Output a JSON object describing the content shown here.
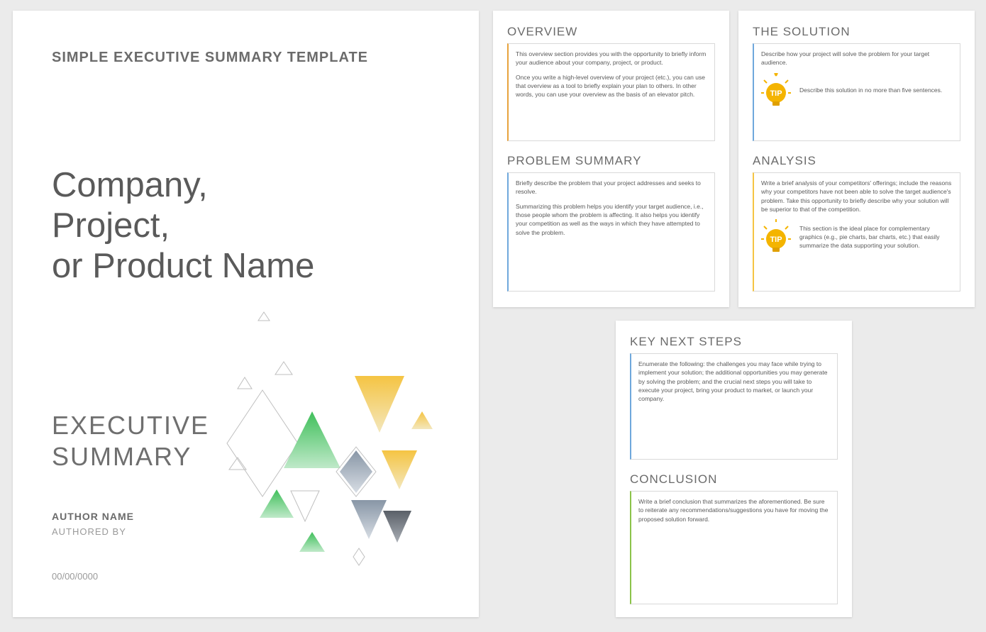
{
  "cover": {
    "template_title": "SIMPLE EXECUTIVE SUMMARY TEMPLATE",
    "main_title_l1": "Company,",
    "main_title_l2": "Project,",
    "main_title_l3": "or Product Name",
    "exec_l1": "EXECUTIVE",
    "exec_l2": "SUMMARY",
    "author_name": "AUTHOR NAME",
    "authored_by": "AUTHORED BY",
    "date": "00/00/0000"
  },
  "page2": {
    "overview": {
      "heading": "OVERVIEW",
      "p1": "This overview section provides you with the opportunity to briefly inform your audience about your company, project, or product.",
      "p2": "Once you write a high-level overview of your project (etc.), you can use that overview as a tool to briefly explain your plan to others. In other words, you can use your overview as the basis of an elevator pitch."
    },
    "problem": {
      "heading": "PROBLEM SUMMARY",
      "p1": "Briefly describe the problem that your project addresses and seeks to resolve.",
      "p2": "Summarizing this problem helps you identify your target audience, i.e., those people whom the problem is affecting. It also helps you identify your competition as well as the ways in which they have attempted to solve the problem."
    }
  },
  "page3": {
    "solution": {
      "heading": "THE SOLUTION",
      "p1": "Describe how your project will solve the problem for your target audience.",
      "tip": "Describe this solution in no more than five sentences."
    },
    "analysis": {
      "heading": "ANALYSIS",
      "p1": "Write a brief analysis of your competitors' offerings; include the reasons why your competitors have not been able to solve the target audience's problem. Take this opportunity to briefly describe why your solution will be superior to that of the competition.",
      "tip": "This section is the ideal place for complementary graphics (e.g., pie charts, bar charts, etc.) that easily summarize the data supporting your solution."
    }
  },
  "page4": {
    "keynext": {
      "heading": "KEY NEXT STEPS",
      "p1": "Enumerate the following: the challenges you may face while trying to implement your solution; the additional opportunities you may generate by solving the problem; and the crucial next steps you will take to execute your project, bring your product to market, or launch your company."
    },
    "conclusion": {
      "heading": "CONCLUSION",
      "p1": "Write a brief conclusion that summarizes the aforementioned. Be sure to reiterate any recommendations/suggestions you have for moving the proposed solution forward."
    }
  }
}
